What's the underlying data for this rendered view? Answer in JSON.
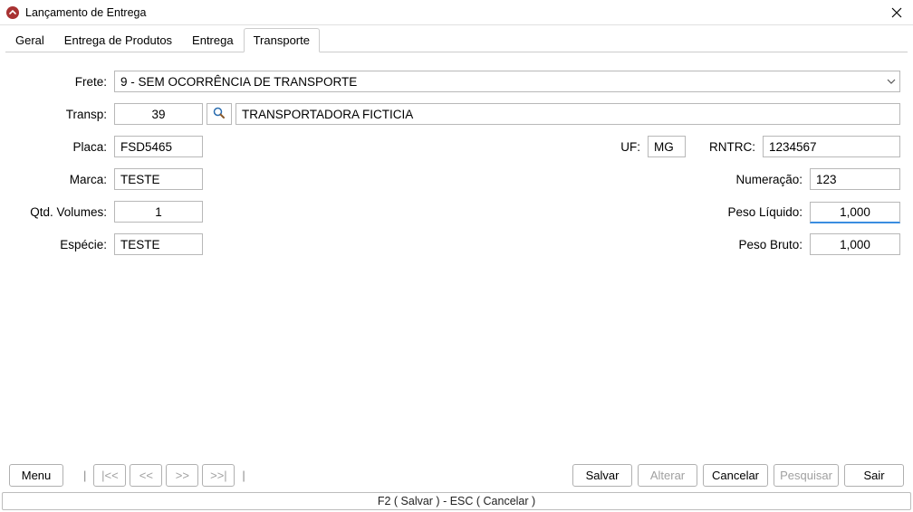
{
  "titlebar": {
    "title": "Lançamento de Entrega"
  },
  "tabs": {
    "items": [
      {
        "label": "Geral"
      },
      {
        "label": "Entrega de Produtos"
      },
      {
        "label": "Entrega"
      },
      {
        "label": "Transporte"
      }
    ],
    "active_index": 3
  },
  "form": {
    "frete": {
      "label": "Frete:",
      "value": "9 - SEM OCORRÊNCIA DE TRANSPORTE"
    },
    "transp": {
      "label": "Transp:",
      "code": "39",
      "name": "TRANSPORTADORA FICTICIA"
    },
    "placa": {
      "label": "Placa:",
      "value": "FSD5465"
    },
    "uf": {
      "label": "UF:",
      "value": "MG"
    },
    "rntrc": {
      "label": "RNTRC:",
      "value": "1234567"
    },
    "marca": {
      "label": "Marca:",
      "value": "TESTE"
    },
    "numeracao": {
      "label": "Numeração:",
      "value": "123"
    },
    "qtd_volumes": {
      "label": "Qtd. Volumes:",
      "value": "1"
    },
    "peso_liquido": {
      "label": "Peso Líquido:",
      "value": "1,000"
    },
    "especie": {
      "label": "Espécie:",
      "value": "TESTE"
    },
    "peso_bruto": {
      "label": "Peso Bruto:",
      "value": "1,000"
    }
  },
  "footer": {
    "menu": "Menu",
    "nav_first": "|<<",
    "nav_prev": "<<",
    "nav_next": ">>",
    "nav_last": ">>|",
    "salvar": "Salvar",
    "alterar": "Alterar",
    "cancelar": "Cancelar",
    "pesquisar": "Pesquisar",
    "sair": "Sair"
  },
  "statusbar": {
    "text": "F2 ( Salvar )  -  ESC ( Cancelar )"
  }
}
